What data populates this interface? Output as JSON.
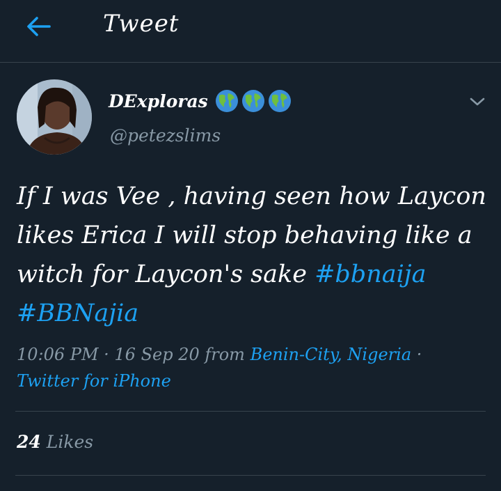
{
  "header": {
    "title": "Tweet",
    "back_icon": "arrow-left-icon",
    "accent": "#1da1f2"
  },
  "author": {
    "display_name": "DExploras",
    "handle": "@petezslims",
    "badges": [
      "globe-icon",
      "globe-icon",
      "globe-icon"
    ],
    "menu_icon": "chevron-down-icon"
  },
  "tweet": {
    "text": "If I was Vee , having seen how Laycon likes Erica I will stop behaving like a witch for Laycon's sake ",
    "hashtags": [
      "#bbnaija",
      "#BBNajia"
    ]
  },
  "meta": {
    "time": "10:06 PM",
    "sep1": " · ",
    "date": "16 Sep 20",
    "from": " from ",
    "location": "Benin-City, Nigeria",
    "sep2": " · ",
    "source": "Twitter for iPhone"
  },
  "stats": {
    "likes_count": "24",
    "likes_label": "Likes"
  },
  "colors": {
    "background": "#15202b",
    "divider": "#38444d",
    "secondary_text": "#8899a6",
    "link": "#1da1f2"
  }
}
